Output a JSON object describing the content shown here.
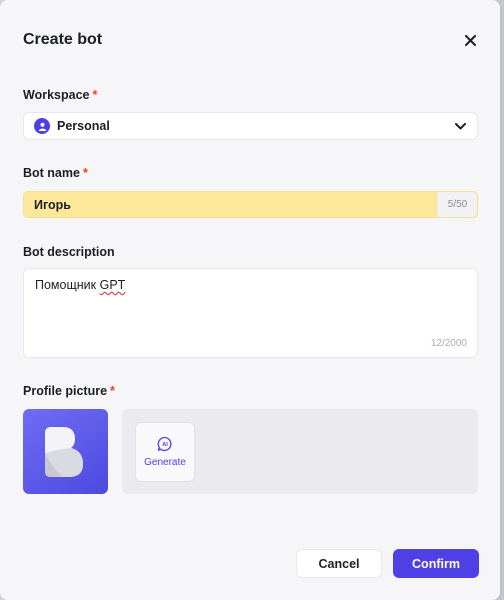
{
  "modal": {
    "title": "Create bot",
    "close_icon": "close-icon"
  },
  "workspace": {
    "label": "Workspace",
    "required_mark": "*",
    "selected": "Personal",
    "icon": "user-icon"
  },
  "bot_name": {
    "label": "Bot name",
    "required_mark": "*",
    "value": "Игорь",
    "counter": "5/50"
  },
  "bot_description": {
    "label": "Bot description",
    "value_prefix": "Помощник ",
    "value_misspelled": "GPT",
    "counter": "12/2000"
  },
  "profile_picture": {
    "label": "Profile picture",
    "required_mark": "*",
    "generate_label": "Generate",
    "generate_icon": "ai-sparkle-icon"
  },
  "footer": {
    "cancel_label": "Cancel",
    "confirm_label": "Confirm"
  },
  "colors": {
    "accent": "#4e40e5",
    "required": "#f93920",
    "name_highlight": "#fde89a",
    "modal_bg": "#f6f6f8"
  }
}
